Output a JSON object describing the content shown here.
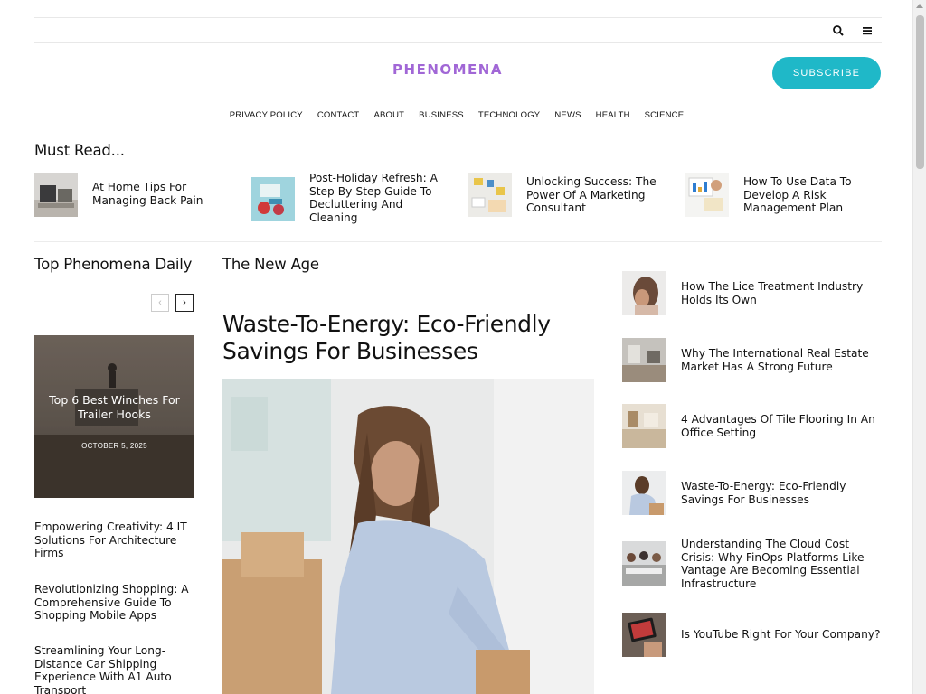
{
  "site": {
    "logo": "PHENOMENA",
    "subscribe_label": "SUBSCRIBE",
    "accent_color": "#1fb8c8",
    "logo_color": "#a167d6"
  },
  "nav": [
    "PRIVACY POLICY",
    "CONTACT",
    "ABOUT",
    "BUSINESS",
    "TECHNOLOGY",
    "NEWS",
    "HEALTH",
    "SCIENCE"
  ],
  "must_read": {
    "heading": "Must Read...",
    "items": [
      {
        "title": "At Home Tips For Managing Back Pain"
      },
      {
        "title": "Post-Holiday Refresh: A Step-By-Step Guide To Decluttering And Cleaning"
      },
      {
        "title": "Unlocking Success: The Power Of A Marketing Consultant"
      },
      {
        "title": "How To Use Data To Develop A Risk Management Plan"
      }
    ]
  },
  "top_daily": {
    "heading": "Top Phenomena Daily",
    "prev_icon": "‹",
    "next_icon": "›",
    "featured": {
      "title": "Top 6 Best Winches For Trailer Hooks",
      "date": "OCTOBER 5, 2025"
    },
    "list": [
      "Empowering Creativity: 4 IT Solutions For Architecture Firms",
      "Revolutionizing Shopping: A Comprehensive Guide To Shopping Mobile Apps",
      "Streamlining Your Long-Distance Car Shipping Experience With A1 Auto Transport"
    ]
  },
  "new_age": {
    "heading": "The New Age",
    "headline": "Waste-To-Energy: Eco-Friendly Savings For Businesses"
  },
  "right_list": [
    "How The Lice Treatment Industry Holds Its Own",
    "Why The International Real Estate Market Has A Strong Future",
    "4 Advantages Of Tile Flooring In An Office Setting",
    "Waste-To-Energy: Eco-Friendly Savings For Businesses",
    "Understanding The Cloud Cost Crisis: Why FinOps Platforms Like Vantage Are Becoming Essential Infrastructure",
    "Is YouTube Right For Your Company?"
  ],
  "icons": {
    "search": "search-icon",
    "menu": "hamburger-menu-icon"
  }
}
